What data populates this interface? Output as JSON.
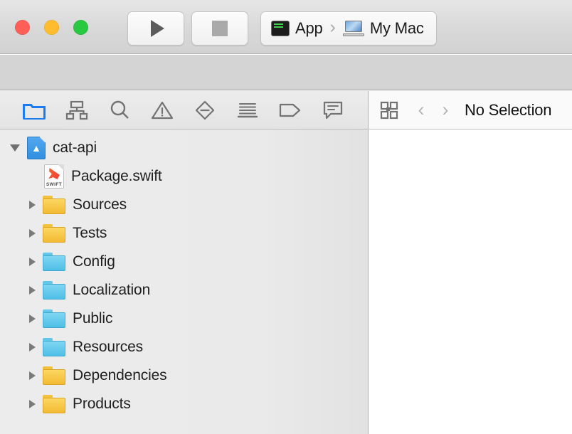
{
  "window": {
    "traffic_lights": [
      {
        "name": "close",
        "color": "#ff5f57"
      },
      {
        "name": "minimize",
        "color": "#febc2e"
      },
      {
        "name": "zoom",
        "color": "#28c840"
      }
    ]
  },
  "toolbar": {
    "run_label": "Run",
    "stop_label": "Stop",
    "scheme": {
      "target_name": "App",
      "target_icon": "terminal-icon",
      "separator": "›",
      "destination_name": "My Mac",
      "destination_icon": "laptop-icon"
    }
  },
  "navigator": {
    "tabs": [
      {
        "name": "project-navigator",
        "icon": "folder-icon",
        "selected": true
      },
      {
        "name": "source-control-navigator",
        "icon": "source-control-icon",
        "selected": false
      },
      {
        "name": "find-navigator",
        "icon": "search-icon",
        "selected": false
      },
      {
        "name": "issue-navigator",
        "icon": "warning-triangle-icon",
        "selected": false
      },
      {
        "name": "test-navigator",
        "icon": "breakpoint-diamond-icon",
        "selected": false
      },
      {
        "name": "report-navigator",
        "icon": "report-lines-icon",
        "selected": false
      },
      {
        "name": "tag-navigator",
        "icon": "tag-icon",
        "selected": false
      },
      {
        "name": "comment-navigator",
        "icon": "comment-bubble-icon",
        "selected": false
      }
    ],
    "tree": [
      {
        "label": "cat-api",
        "icon": "xcode-project-icon",
        "depth": 0,
        "disclosure": "open",
        "indent": 14
      },
      {
        "label": "Package.swift",
        "icon": "swift-file-icon",
        "depth": 1,
        "disclosure": "none",
        "indent": 62
      },
      {
        "label": "Sources",
        "icon": "folder-yellow-icon",
        "depth": 1,
        "disclosure": "collapsed",
        "indent": 41
      },
      {
        "label": "Tests",
        "icon": "folder-yellow-icon",
        "depth": 1,
        "disclosure": "collapsed",
        "indent": 41
      },
      {
        "label": "Config",
        "icon": "folder-blue-icon",
        "depth": 1,
        "disclosure": "collapsed",
        "indent": 41
      },
      {
        "label": "Localization",
        "icon": "folder-blue-icon",
        "depth": 1,
        "disclosure": "collapsed",
        "indent": 41
      },
      {
        "label": "Public",
        "icon": "folder-blue-icon",
        "depth": 1,
        "disclosure": "collapsed",
        "indent": 41
      },
      {
        "label": "Resources",
        "icon": "folder-blue-icon",
        "depth": 1,
        "disclosure": "collapsed",
        "indent": 41
      },
      {
        "label": "Dependencies",
        "icon": "folder-yellow-icon",
        "depth": 1,
        "disclosure": "collapsed",
        "indent": 41
      },
      {
        "label": "Products",
        "icon": "folder-yellow-icon",
        "depth": 1,
        "disclosure": "collapsed",
        "indent": 41
      }
    ]
  },
  "editor": {
    "jumpbar": {
      "related_items_icon": "related-items-grid-icon",
      "back_chevron": "‹",
      "forward_chevron": "›",
      "title": "No Selection"
    }
  },
  "colors": {
    "accent": "#1a7cf0",
    "folder_yellow": "#f3bb33",
    "folder_blue": "#4fbfe6",
    "titlebar": "#d8d8d8",
    "navigator_bg": "#eaeaea"
  }
}
